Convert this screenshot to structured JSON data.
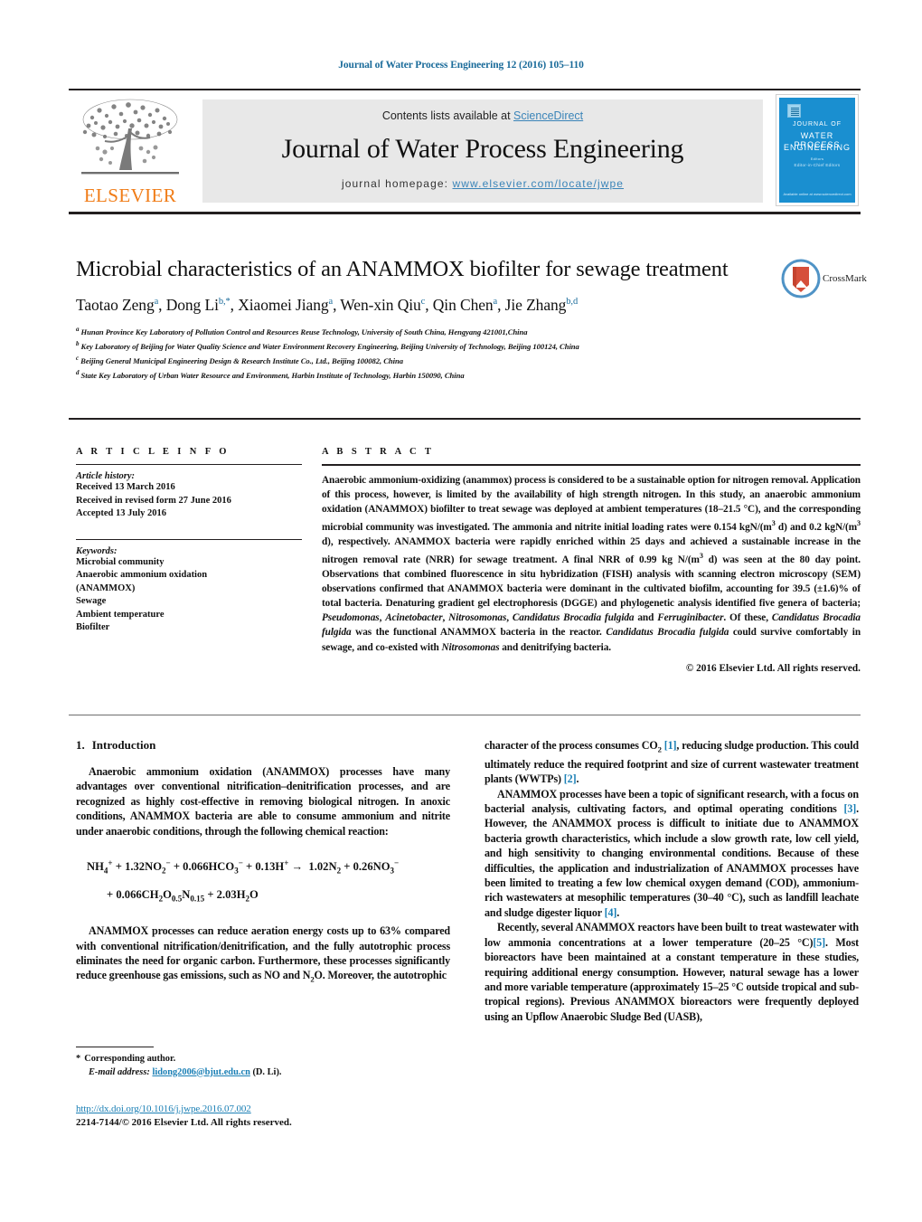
{
  "running_head": "Journal of Water Process Engineering 12 (2016) 105–110",
  "masthead": {
    "contents_prefix": "Contents lists available at ",
    "sciencedirect": "ScienceDirect",
    "journal_title": "Journal of Water Process Engineering",
    "homepage_prefix": "journal homepage: ",
    "homepage_url": "www.elsevier.com/locate/jwpe",
    "publisher": "ELSEVIER",
    "cover": {
      "line1": "JOURNAL OF",
      "line2": "WATER PROCESS",
      "line3": "ENGINEERING",
      "editors_label": "Editors",
      "editors": "Editor-in-Chief   Editors",
      "footer": "Available online at www.sciencedirect.com"
    },
    "accent_link_color": "#3a84b8",
    "elsevier_orange": "#f07c17",
    "band_color": "#e8e8e8"
  },
  "crossmark": {
    "label": "CrossMark"
  },
  "article": {
    "title": "Microbial characteristics of an ANAMMOX biofilter for sewage treatment",
    "authors_html": "Taotao Zeng<sup class=\"aff-marker\">a</sup>, Dong Li<sup class=\"aff-marker\">b,*</sup>, Xiaomei Jiang<sup class=\"aff-marker\">a</sup>, Wen-xin Qiu<sup class=\"aff-marker\">c</sup>, Qin Chen<sup class=\"aff-marker\">a</sup>, Jie Zhang<sup class=\"aff-marker\">b,d</sup>",
    "affiliations": [
      {
        "mark": "a",
        "text": "Hunan Province Key Laboratory of Pollution Control and Resources Reuse Technology, University of South China, Hengyang 421001,China"
      },
      {
        "mark": "b",
        "text": "Key Laboratory of Beijing for Water Quality Science and Water Environment Recovery Engineering, Beijing University of Technology, Beijing 100124, China"
      },
      {
        "mark": "c",
        "text": "Beijing General Municipal Engineering Design & Research Institute Co., Ltd., Beijing 100082, China"
      },
      {
        "mark": "d",
        "text": "State Key Laboratory of Urban Water Resource and Environment, Harbin Institute of Technology, Harbin 150090, China"
      }
    ]
  },
  "article_info": {
    "heading": "A R T I C L E    I N F O",
    "history_label": "Article history:",
    "history": [
      "Received 13 March 2016",
      "Received in revised form 27 June 2016",
      "Accepted 13 July 2016"
    ],
    "keywords_label": "Keywords:",
    "keywords": [
      "Microbial community",
      "Anaerobic ammonium oxidation",
      "(ANAMMOX)",
      "Sewage",
      "Ambient temperature",
      "Biofilter"
    ]
  },
  "abstract": {
    "heading": "A B S T R A C T",
    "body_html": "Anaerobic ammonium-oxidizing (anammox) process is considered to be a sustainable option for nitrogen removal. Application of this process, however, is limited by the availability of high strength nitrogen. In this study, an anaerobic ammonium oxidation (ANAMMOX) biofilter to treat sewage was deployed at ambient temperatures (18&ndash;21.5 &deg;C), and the corresponding microbial community was investigated. The ammonia and nitrite initial loading rates were 0.154 kgN/(m<sup>3</sup> d) and 0.2 kgN/(m<sup>3</sup> d), respectively. ANAMMOX bacteria were rapidly enriched within 25 days and achieved a sustainable increase in the nitrogen removal rate (NRR) for sewage treatment. A final NRR of 0.99 kg N/(m<sup>3</sup> d) was seen at the 80 day point. Observations that combined fluorescence in situ hybridization (FISH) analysis with scanning electron microscopy (SEM) observations confirmed that ANAMMOX bacteria were dominant in the cultivated biofilm, accounting for 39.5 (&plusmn;1.6)% of total bacteria. Denaturing gradient gel electrophoresis (DGGE) and phylogenetic analysis identified five genera of bacteria; <i>Pseudomonas</i>, <i>Acinetobacter</i>, <i>Nitrosomonas</i>, <i>Candidatus Brocadia fulgida</i> and <i>Ferruginibacter</i>. Of these, <i>Candidatus Brocadia fulgida</i> was the functional ANAMMOX bacteria in the reactor. <i>Candidatus Brocadia fulgida</i> could survive comfortably in sewage, and co-existed with <i>Nitrosomonas</i> and denitrifying bacteria.",
    "copyright": "© 2016 Elsevier Ltd. All rights reserved."
  },
  "body": {
    "section_number": "1.",
    "section_title": "Introduction",
    "left_paragraphs_html": [
      "Anaerobic ammonium oxidation (ANAMMOX) processes have many advantages over conventional nitrification&ndash;denitrification processes, and are recognized as highly cost-effective in removing biological nitrogen. In anoxic conditions, ANAMMOX bacteria are able to consume ammonium and nitrite under anaerobic conditions, through the following chemical reaction:",
      "ANAMMOX processes can reduce aeration energy costs up to 63% compared with conventional nitrification/denitrification, and the fully autotrophic process eliminates the need for organic carbon. Furthermore, these processes significantly reduce greenhouse gas emissions, such as NO and N<sub>2</sub>O. Moreover, the autotrophic"
    ],
    "equation_line1_html": "NH<sub>4</sub><sup>+</sup> + 1.32NO<sub>2</sub><sup>&minus;</sup> + 0.066HCO<sub>3</sub><sup>&minus;</sup> + 0.13H<sup>+</sup> &rarr;&nbsp; 1.02N<sub>2</sub> + 0.26NO<sub>3</sub><sup>&minus;</sup>",
    "equation_line2_html": "+ 0.066CH<sub>2</sub>O<sub>0.5</sub>N<sub>0.15</sub> + 2.03H<sub>2</sub>O",
    "right_paragraphs_html": [
      "character of the process consumes CO<sub>2</sub> <span class=\"ref\">[1]</span>, reducing sludge production. This could ultimately reduce the required footprint and size of current wastewater treatment plants (WWTPs) <span class=\"ref\">[2]</span>.",
      "ANAMMOX processes have been a topic of significant research, with a focus on bacterial analysis, cultivating factors, and optimal operating conditions <span class=\"ref\">[3]</span>. However, the ANAMMOX process is difficult to initiate due to ANAMMOX bacteria growth characteristics, which include a slow growth rate, low cell yield, and high sensitivity to changing environmental conditions. Because of these difficulties, the application and industrialization of ANAMMOX processes have been limited to treating a few low chemical oxygen demand (COD), ammonium-rich wastewaters at mesophilic temperatures (30&ndash;40&nbsp;&deg;C), such as landfill leachate and sludge digester liquor <span class=\"ref\">[4]</span>.",
      "Recently, several ANAMMOX reactors have been built to treat wastewater with low ammonia concentrations at a lower temperature (20&ndash;25&nbsp;&deg;C)<span class=\"ref\">[5]</span>. Most bioreactors have been maintained at a constant temperature in these studies, requiring additional energy consumption. However, natural sewage has a lower and more variable temperature (approximately 15&ndash;25 &deg;C outside tropical and sub-tropical regions). Previous ANAMMOX bioreactors were frequently deployed using an Upflow Anaerobic Sludge Bed (UASB),"
    ]
  },
  "footer": {
    "corresponding_marker": "*",
    "corresponding_label": "Corresponding author.",
    "email_label": "E-mail address:",
    "email": "lidong2006@bjut.edu.cn",
    "email_owner": "(D. Li).",
    "doi": "http://dx.doi.org/10.1016/j.jwpe.2016.07.002",
    "issn_line": "2214-7144/© 2016 Elsevier Ltd. All rights reserved.",
    "link_color": "#1a7fb5"
  }
}
